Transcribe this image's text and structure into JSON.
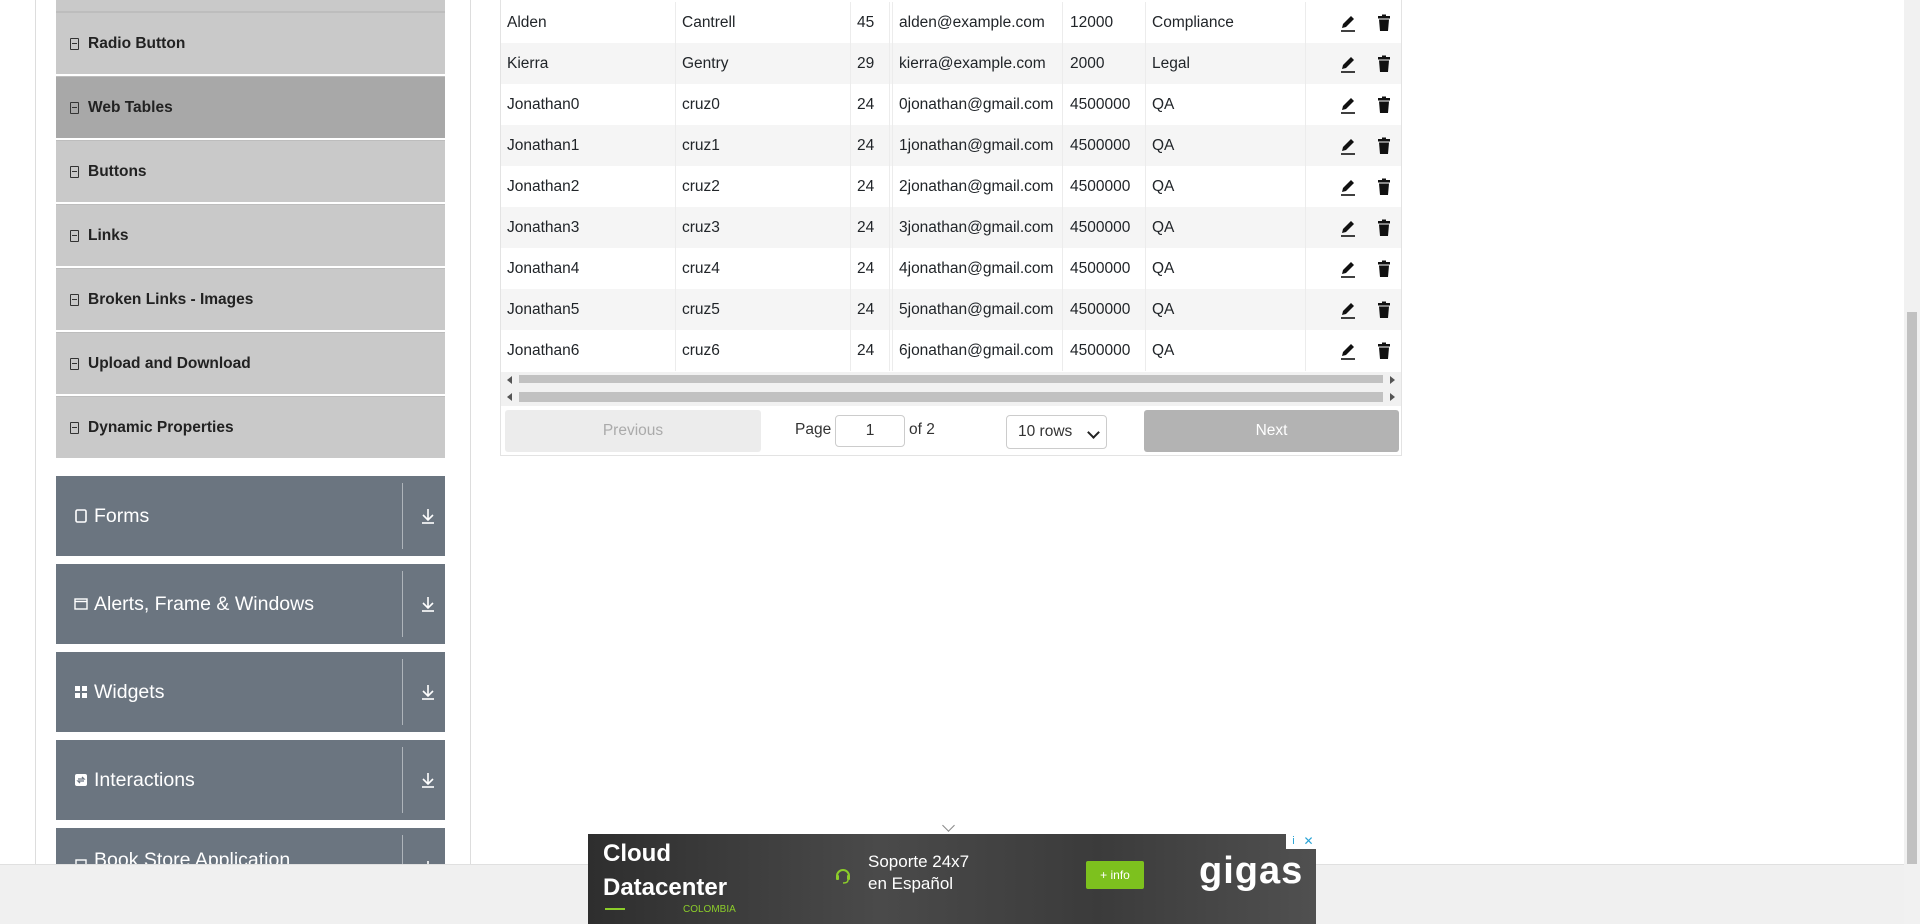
{
  "sidebar": {
    "elements_items": [
      {
        "label": "Radio Button",
        "active": false
      },
      {
        "label": "Web Tables",
        "active": true
      },
      {
        "label": "Buttons",
        "active": false
      },
      {
        "label": "Links",
        "active": false
      },
      {
        "label": "Broken Links - Images",
        "active": false
      },
      {
        "label": "Upload and Download",
        "active": false
      },
      {
        "label": "Dynamic Properties",
        "active": false
      }
    ],
    "groups": [
      {
        "label": "Forms",
        "icon": "form-icon"
      },
      {
        "label": "Alerts, Frame & Windows",
        "icon": "window-icon"
      },
      {
        "label": "Widgets",
        "icon": "widgets-icon"
      },
      {
        "label": "Interactions",
        "icon": "interactions-icon"
      },
      {
        "label": "Book Store Application",
        "icon": "book-icon"
      }
    ]
  },
  "table": {
    "rows": [
      [
        "Alden",
        "Cantrell",
        "45",
        "alden@example.com",
        "12000",
        "Compliance"
      ],
      [
        "Kierra",
        "Gentry",
        "29",
        "kierra@example.com",
        "2000",
        "Legal"
      ],
      [
        "Jonathan0",
        "cruz0",
        "24",
        "0jonathan@gmail.com",
        "4500000",
        "QA"
      ],
      [
        "Jonathan1",
        "cruz1",
        "24",
        "1jonathan@gmail.com",
        "4500000",
        "QA"
      ],
      [
        "Jonathan2",
        "cruz2",
        "24",
        "2jonathan@gmail.com",
        "4500000",
        "QA"
      ],
      [
        "Jonathan3",
        "cruz3",
        "24",
        "3jonathan@gmail.com",
        "4500000",
        "QA"
      ],
      [
        "Jonathan4",
        "cruz4",
        "24",
        "4jonathan@gmail.com",
        "4500000",
        "QA"
      ],
      [
        "Jonathan5",
        "cruz5",
        "24",
        "5jonathan@gmail.com",
        "4500000",
        "QA"
      ],
      [
        "Jonathan6",
        "cruz6",
        "24",
        "6jonathan@gmail.com",
        "4500000",
        "QA"
      ]
    ]
  },
  "pagination": {
    "previous_label": "Previous",
    "page_label": "Page",
    "page_value": "1",
    "of_label": "of 2",
    "rows_label": "10 rows",
    "next_label": "Next"
  },
  "ad": {
    "title_line1": "Cloud",
    "title_line2": "Datacenter",
    "country": "COLOMBIA",
    "support_line1": "Soporte 24x7",
    "support_line2": "en Español",
    "info_button": "+ info",
    "brand": "gigas",
    "adchoices": "i",
    "close": "✕"
  },
  "colors": {
    "sidebar_item_bg": "#c9c9c9",
    "sidebar_item_active_bg": "#a8a8a8",
    "group_bg": "#6b7580",
    "ad_green": "#7dc11e"
  }
}
